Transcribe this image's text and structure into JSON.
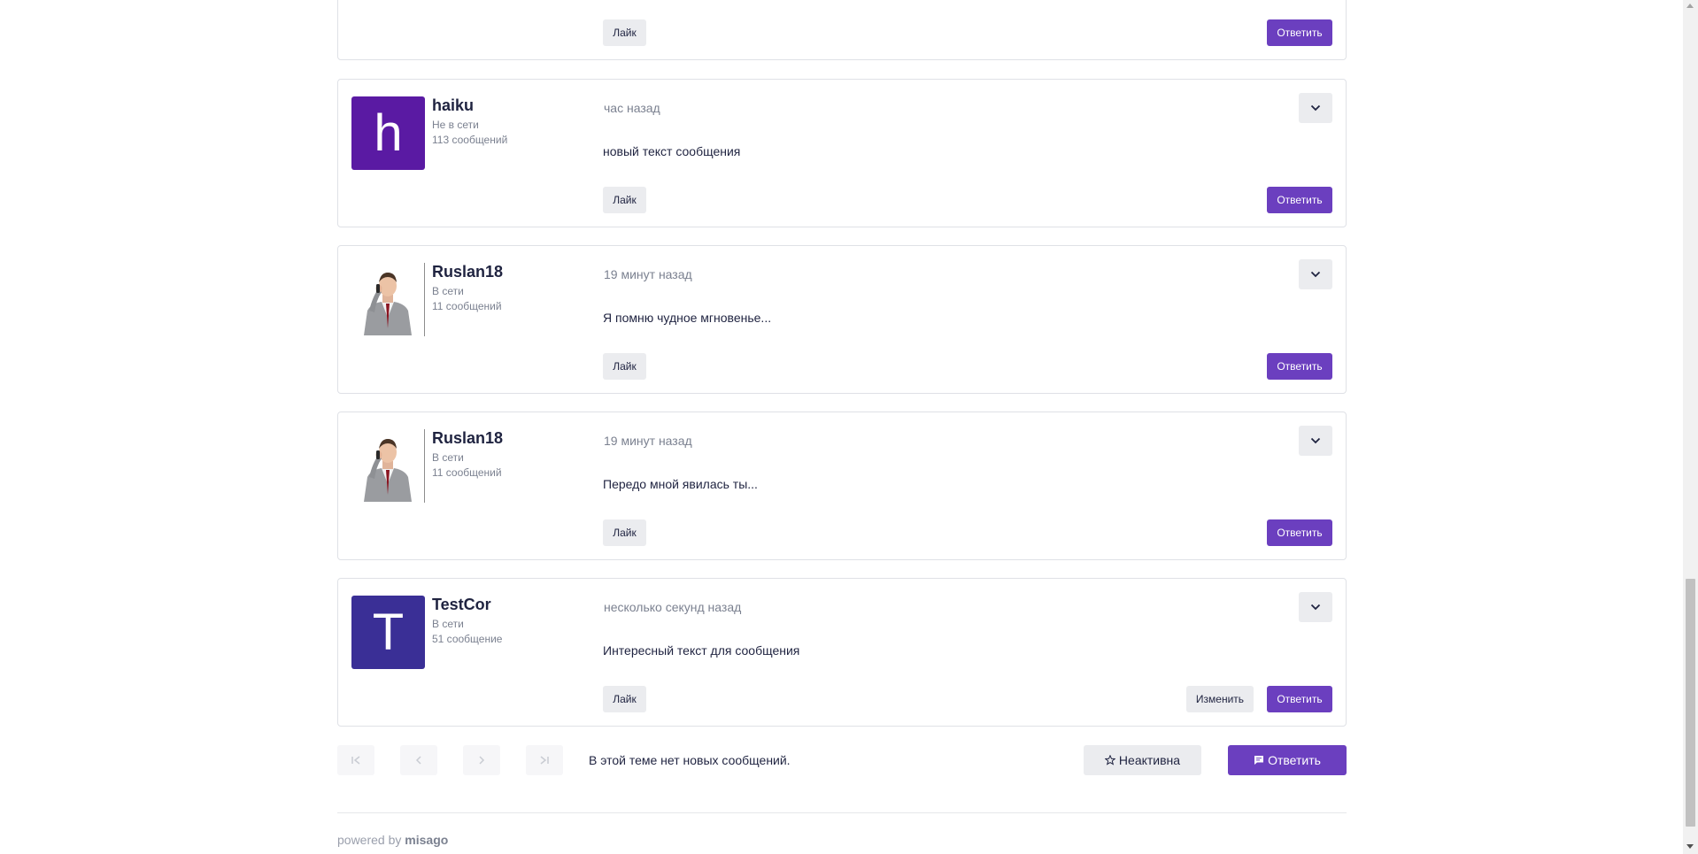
{
  "posts": [
    {
      "avatar_type": "none",
      "like_label": "Лайк",
      "reply_label": "Ответить"
    },
    {
      "avatar_type": "letter",
      "avatar_letter": "h",
      "avatar_color": "#5a1aa3",
      "username": "haiku",
      "status": "Не в сети",
      "count": "113 сообщений",
      "time": "час назад",
      "text": "новый текст сообщения",
      "like_label": "Лайк",
      "reply_label": "Ответить"
    },
    {
      "avatar_type": "photo",
      "username": "Ruslan18",
      "status": "В сети",
      "count": "11 сообщений",
      "time": "19 минут назад",
      "text": "Я помню чудное мгновенье...",
      "like_label": "Лайк",
      "reply_label": "Ответить"
    },
    {
      "avatar_type": "photo",
      "username": "Ruslan18",
      "status": "В сети",
      "count": "11 сообщений",
      "time": "19 минут назад",
      "text": "Передо мной явилась ты...",
      "like_label": "Лайк",
      "reply_label": "Ответить"
    },
    {
      "avatar_type": "letter",
      "avatar_letter": "T",
      "avatar_color": "#3a2f96",
      "username": "TestCor",
      "status": "В сети",
      "count": "51 сообщение",
      "time": "несколько секунд назад",
      "text": "Интересный текст для сообщения",
      "like_label": "Лайк",
      "edit_label": "Изменить",
      "reply_label": "Ответить"
    }
  ],
  "pager": {
    "no_new_text": "В этой теме нет новых сообщений.",
    "inactive_label": "Неактивна",
    "reply_label": "Ответить"
  },
  "footer": {
    "powered_by": "powered by",
    "brand": "misago"
  },
  "colors": {
    "accent": "#6b3fbf",
    "muted": "#7b8190",
    "button_grey": "#ebecef"
  }
}
